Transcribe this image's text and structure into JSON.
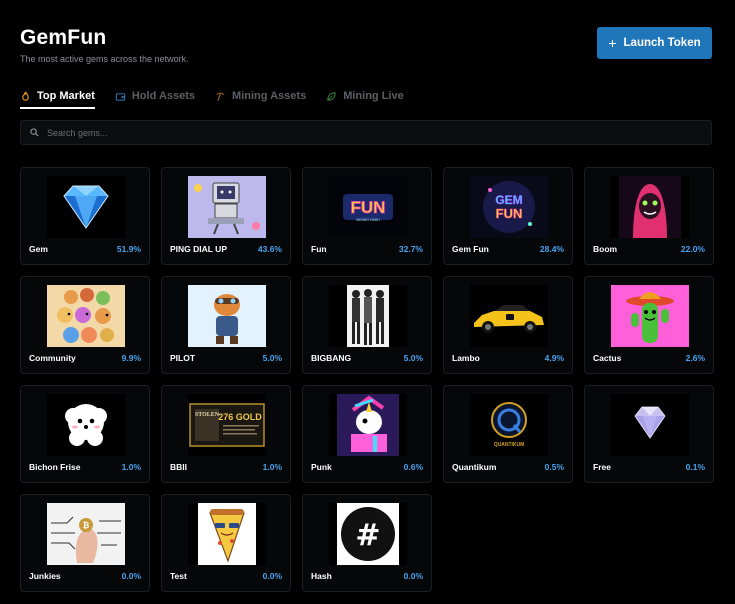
{
  "header": {
    "title": "GemFun",
    "subtitle": "The most active gems across the network."
  },
  "actions": {
    "launch_label": "Launch Token",
    "launch_icon": "plus-icon"
  },
  "tabs": [
    {
      "label": "Top Market",
      "icon": "flame-icon",
      "active": true
    },
    {
      "label": "Hold Assets",
      "icon": "wallet-icon",
      "active": false
    },
    {
      "label": "Mining Assets",
      "icon": "pickaxe-icon",
      "active": false
    },
    {
      "label": "Mining Live",
      "icon": "leaf-icon",
      "active": false
    }
  ],
  "search": {
    "placeholder": "Search gems...",
    "value": ""
  },
  "gems": [
    {
      "name": "Gem",
      "pct": "51.9%",
      "image": "blue-diamond"
    },
    {
      "name": "PING DIAL UP",
      "pct": "43.6%",
      "image": "retro-computer"
    },
    {
      "name": "Fun",
      "pct": "32.7%",
      "image": "fun-logo"
    },
    {
      "name": "Gem Fun",
      "pct": "28.4%",
      "image": "gem-fun-logo"
    },
    {
      "name": "Boom",
      "pct": "22.0%",
      "image": "pink-hood-character"
    },
    {
      "name": "Community",
      "pct": "9.9%",
      "image": "cartoon-crowd"
    },
    {
      "name": "PILOT",
      "pct": "5.0%",
      "image": "pilot-cat"
    },
    {
      "name": "BIGBANG",
      "pct": "5.0%",
      "image": "band-photo"
    },
    {
      "name": "Lambo",
      "pct": "4.9%",
      "image": "yellow-sports-car"
    },
    {
      "name": "Cactus",
      "pct": "2.6%",
      "image": "cactus-sombrero"
    },
    {
      "name": "Bichon Frise",
      "pct": "1.0%",
      "image": "white-dog"
    },
    {
      "name": "BBII",
      "pct": "1.0%",
      "image": "stolen-gold-poster"
    },
    {
      "name": "Punk",
      "pct": "0.6%",
      "image": "punk-unicorn"
    },
    {
      "name": "Quantikum",
      "pct": "0.5%",
      "image": "quantikum-logo"
    },
    {
      "name": "Free",
      "pct": "0.1%",
      "image": "light-diamond"
    },
    {
      "name": "Junkies",
      "pct": "0.0%",
      "image": "circuit-hand"
    },
    {
      "name": "Test",
      "pct": "0.0%",
      "image": "pizza-slice"
    },
    {
      "name": "Hash",
      "pct": "0.0%",
      "image": "hash-symbol"
    }
  ],
  "image_text": {
    "fun": "FUN",
    "fun_sub": "MINING HASH",
    "gemfun_1": "GEM",
    "gemfun_2": "FUN",
    "stolen": "STOLEN",
    "gold": "276 GOLD",
    "quantikum": "QUANTIKUM",
    "hash": "#"
  },
  "colors": {
    "background": "#000000",
    "accent": "#1f76b8",
    "percent": "#4aa3f0",
    "active_tab_icon": "#f0a020"
  }
}
